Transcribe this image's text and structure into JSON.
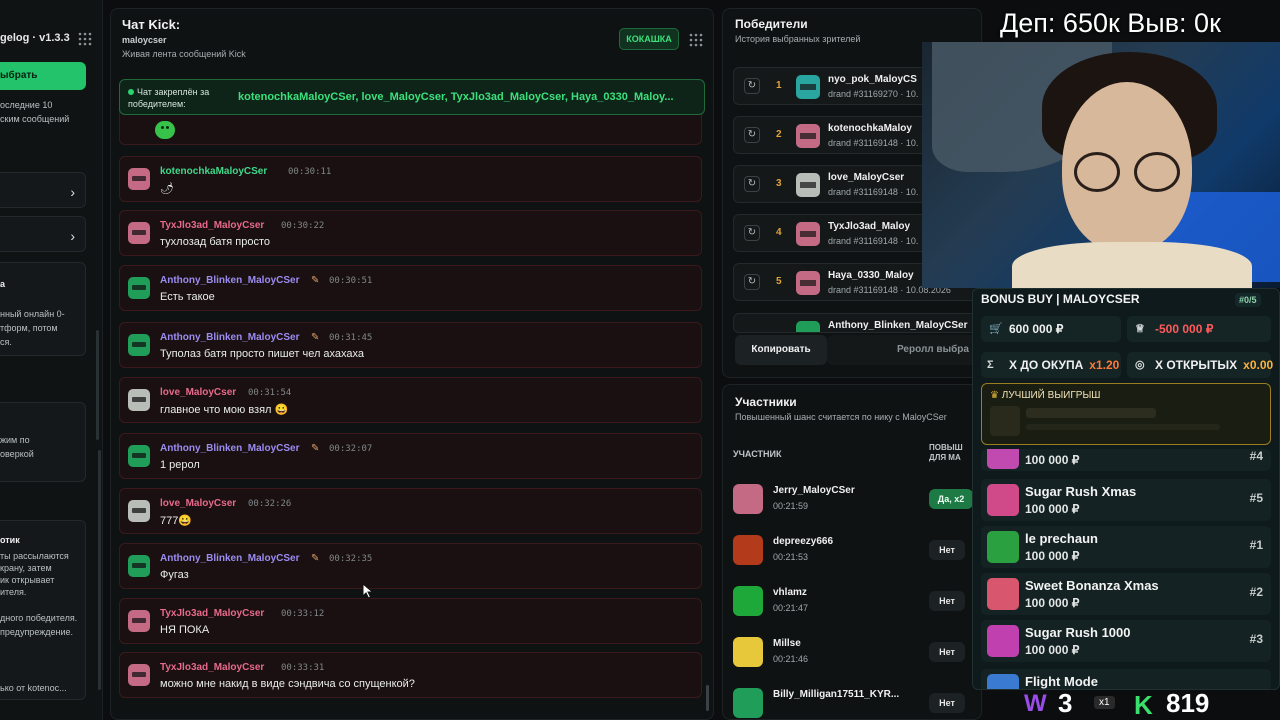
{
  "left": {
    "version": "gelog · v1.3.3",
    "pick_button": "ыбрать",
    "texts_a": [
      "оследние 10",
      "ским сообщений"
    ],
    "texts_b": [
      "а",
      "нный онлайн 0-",
      "тформ, потом",
      "ся."
    ],
    "texts_c": [
      "жим по",
      "оверкой"
    ],
    "texts_d_title": "отик",
    "texts_d": [
      "ты рассылаются",
      "крану, затем",
      "ик открывает",
      "ителя."
    ],
    "texts_e": [
      "дного победителя.",
      "предупреждение."
    ],
    "texts_f": "ько от kotenoc..."
  },
  "chat": {
    "title": "Чат Kick:",
    "channel": "maloycser",
    "subtitle": "Живая лента сообщений Kick",
    "kick_button": "КОКАШКА",
    "pinned_label": "Чат закреплён за победителем:",
    "pinned_value": "kotenochkaMaloyCSer, love_MaloyCser, TyxJlo3ad_MaloyCser, Haya_0330_Maloy...",
    "messages": [
      {
        "name": "kotenochkaMaloyCSer",
        "time": "00:30:11",
        "text": "🌶",
        "color": "green",
        "avatar": "pink",
        "badge": false
      },
      {
        "name": "TyxJlo3ad_MaloyCser",
        "time": "00:30:22",
        "text": "тухлозад батя просто",
        "color": "pink",
        "avatar": "pink",
        "badge": false
      },
      {
        "name": "Anthony_Blinken_MaloyCSer",
        "time": "00:30:51",
        "text": "Есть такое",
        "color": "purple",
        "avatar": "green",
        "badge": true
      },
      {
        "name": "Anthony_Blinken_MaloyCSer",
        "time": "00:31:45",
        "text": "Туполаз батя просто пишет чел ахахаха",
        "color": "purple",
        "avatar": "green",
        "badge": true
      },
      {
        "name": "love_MaloyCser",
        "time": "00:31:54",
        "text": "главное что мою взял 😀",
        "color": "pink",
        "avatar": "white",
        "badge": false
      },
      {
        "name": "Anthony_Blinken_MaloyCSer",
        "time": "00:32:07",
        "text": "1 рерол",
        "color": "purple",
        "avatar": "green",
        "badge": true
      },
      {
        "name": "love_MaloyCser",
        "time": "00:32:26",
        "text": "777😀",
        "color": "pink",
        "avatar": "white",
        "badge": false
      },
      {
        "name": "Anthony_Blinken_MaloyCSer",
        "time": "00:32:35",
        "text": "Фугаз",
        "color": "purple",
        "avatar": "green",
        "badge": true
      },
      {
        "name": "TyxJlo3ad_MaloyCser",
        "time": "00:33:12",
        "text": "НЯ ПОКА",
        "color": "pink",
        "avatar": "pink",
        "badge": false
      },
      {
        "name": "TyxJlo3ad_MaloyCser",
        "time": "00:33:31",
        "text": "можно мне накид в виде сэндвича со спущенкой?",
        "color": "pink",
        "avatar": "pink",
        "badge": false
      }
    ]
  },
  "winners": {
    "title": "Победители",
    "subtitle": "История выбранных зрителей",
    "rows": [
      {
        "no": "1",
        "name": "nyo_pok_MaloyCS",
        "draw": "drand #31169270 · 10.",
        "avatar": "#2aa6a0"
      },
      {
        "no": "2",
        "name": "kotenochkaMaloy",
        "draw": "drand #31169148 · 10.",
        "avatar": "#c46a84"
      },
      {
        "no": "3",
        "name": "love_MaloyCser",
        "draw": "drand #31169148 · 10.",
        "avatar": "#b9bdb7"
      },
      {
        "no": "4",
        "name": "TyxJlo3ad_Maloy",
        "draw": "drand #31169148 · 10.",
        "avatar": "#c46a84"
      },
      {
        "no": "5",
        "name": "Haya_0330_Maloy",
        "draw": "drand #31169148 · 10.08.2026",
        "avatar": "#c46a84"
      }
    ],
    "partial_row": "Anthony_Blinken_MaloyCSer",
    "copy_button": "Копировать",
    "reroll_button": "Реролл выбра"
  },
  "participants": {
    "title": "Участники",
    "subtitle": "Повышенный шанс считается по нику с MaloyCSer",
    "col_participant": "УЧАСТНИК",
    "col_boost": "ПОВЫШ ДЛЯ МА",
    "rows": [
      {
        "name": "Jerry_MaloyCSer",
        "time": "00:21:59",
        "badge": "Да, x2",
        "yes": true,
        "avatar": "#c46a84"
      },
      {
        "name": "depreezy666",
        "time": "00:21:53",
        "badge": "Нет",
        "yes": false,
        "avatar": "#b43a1c"
      },
      {
        "name": "vhlamz",
        "time": "00:21:47",
        "badge": "Нет",
        "yes": false,
        "avatar": "#1fa83a"
      },
      {
        "name": "Millse",
        "time": "00:21:46",
        "badge": "Нет",
        "yes": false,
        "avatar": "#e6c83a"
      },
      {
        "name": "Billy_Milligan17511_KYR...",
        "time": "",
        "badge": "Нет",
        "yes": false,
        "avatar": "#1f9d59"
      }
    ]
  },
  "overlay": {
    "dep_text": "Деп: 650к Выв: 0к"
  },
  "bonus": {
    "title": "BONUS BUY | MALOYCSER",
    "counter": "#0/5",
    "cost": "600 000 ₽",
    "profit": "-500 000 ₽",
    "to_payback_label": "Х ДО ОКУПА",
    "to_payback_mult": "x1.20",
    "opened_label": "Х ОТКРЫТЫХ",
    "opened_mult": "x0.00",
    "best_label": "ЛУЧШИЙ ВЫИГРЫШ",
    "partial_price": "100 000 ₽",
    "partial_rank": "#4",
    "slots": [
      {
        "name": "Sugar Rush Xmas",
        "price": "100 000 ₽",
        "rank": "#5",
        "color": "#d04a8a"
      },
      {
        "name": "le prechaun",
        "price": "100 000 ₽",
        "rank": "#1",
        "color": "#2aa040"
      },
      {
        "name": "Sweet Bonanza Xmas",
        "price": "100 000 ₽",
        "rank": "#2",
        "color": "#d8566e"
      },
      {
        "name": "Sugar Rush 1000",
        "price": "100 000 ₽",
        "rank": "#3",
        "color": "#c040b0"
      }
    ],
    "partial_bottom": "Flight Mode"
  },
  "counters": {
    "w_icon": "W",
    "w_value": "3",
    "w_mult": "x1",
    "k_icon": "K",
    "k_value": "819"
  }
}
